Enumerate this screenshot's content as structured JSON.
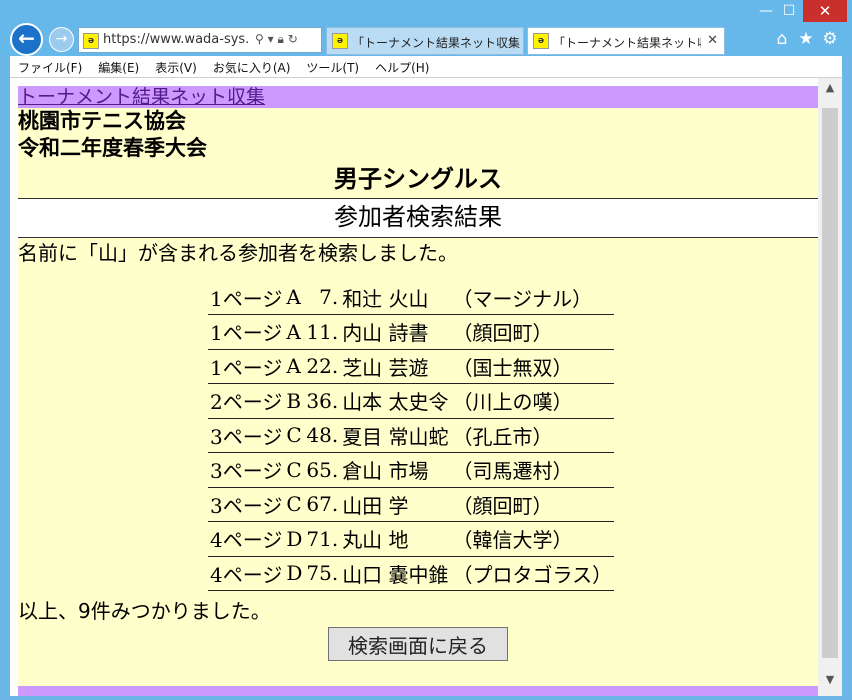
{
  "browser": {
    "url": "https://www.wada-sys...",
    "tabs": [
      {
        "label": "「トーナメント結果ネット収集」トー..."
      },
      {
        "label": "「トーナメント結果ネット収集」..."
      }
    ],
    "menu": [
      "ファイル(F)",
      "編集(E)",
      "表示(V)",
      "お気に入り(A)",
      "ツール(T)",
      "ヘルプ(H)"
    ]
  },
  "page": {
    "top_link": "トーナメント結果ネット収集",
    "organization": "桃園市テニス協会",
    "tournament": "令和二年度春季大会",
    "event": "男子シングルス",
    "section_title": "参加者検索結果",
    "description": "名前に「山」が含まれる参加者を検索しました。",
    "results": [
      {
        "page": "1ページ",
        "block": "A",
        "num": "7.",
        "name": "和辻 火山",
        "team": "（マージナル）"
      },
      {
        "page": "1ページ",
        "block": "A",
        "num": "11.",
        "name": "内山 詩書",
        "team": "（顔回町）"
      },
      {
        "page": "1ページ",
        "block": "A",
        "num": "22.",
        "name": "芝山 芸遊",
        "team": "（国士無双）"
      },
      {
        "page": "2ページ",
        "block": "B",
        "num": "36.",
        "name": "山本 太史令",
        "team": "（川上の嘆）"
      },
      {
        "page": "3ページ",
        "block": "C",
        "num": "48.",
        "name": "夏目 常山蛇",
        "team": "（孔丘市）"
      },
      {
        "page": "3ページ",
        "block": "C",
        "num": "65.",
        "name": "倉山 市場",
        "team": "（司馬遷村）"
      },
      {
        "page": "3ページ",
        "block": "C",
        "num": "67.",
        "name": "山田 学",
        "team": "（顔回町）"
      },
      {
        "page": "4ページ",
        "block": "D",
        "num": "71.",
        "name": "丸山 地",
        "team": "（韓信大学）"
      },
      {
        "page": "4ページ",
        "block": "D",
        "num": "75.",
        "name": "山口 嚢中錐",
        "team": "（プロタゴラス）"
      }
    ],
    "summary": "以上、9件みつかりました。",
    "back_button": "検索画面に戻る"
  }
}
